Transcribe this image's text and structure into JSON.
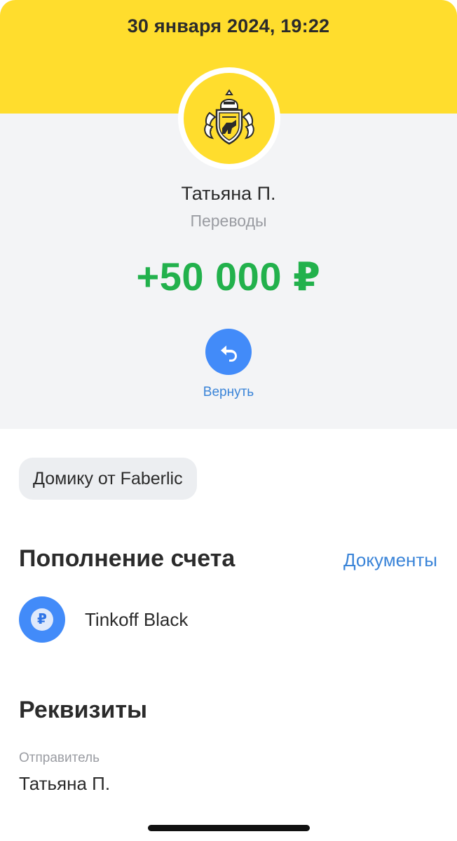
{
  "header": {
    "datetime": "30 января 2024, 19:22",
    "background_color": "#ffdd2d"
  },
  "operation": {
    "logo_icon": "bank-crest-icon",
    "counterparty": "Татьяна П.",
    "category": "Переводы",
    "amount": "+50 000 ₽",
    "amount_color": "#22b14c"
  },
  "actions": {
    "return_icon": "return-arrow-icon",
    "return_label": "Вернуть"
  },
  "message": {
    "text": "Домику от Faberlic"
  },
  "topup": {
    "title": "Пополнение счета",
    "documents_link": "Документы",
    "account_icon": "ruble-icon",
    "account_icon_glyph": "₽",
    "account_name": "Tinkoff Black"
  },
  "requisites": {
    "title": "Реквизиты",
    "sender_label": "Отправитель",
    "sender_value": "Татьяна П."
  },
  "accent_color": "#428bf9"
}
